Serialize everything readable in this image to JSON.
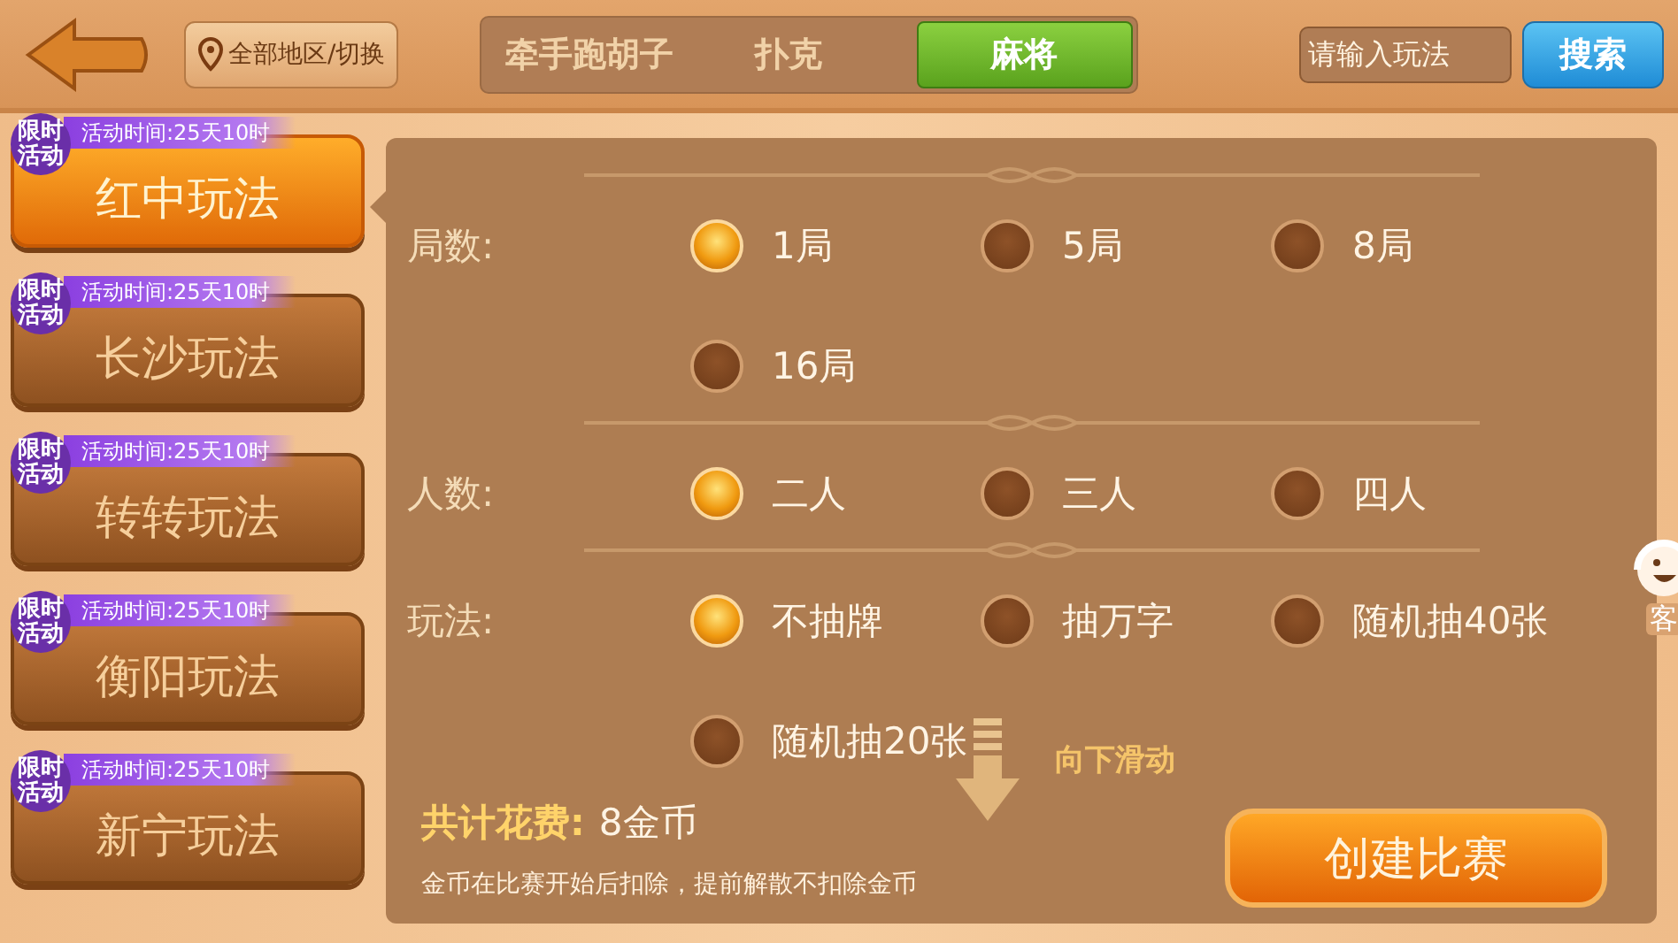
{
  "top_bar": {
    "region_button": "全部地区/切换",
    "tabs": [
      {
        "label": "牵手跑胡子",
        "selected": false
      },
      {
        "label": "扑克",
        "selected": false
      },
      {
        "label": "麻将",
        "selected": true
      }
    ],
    "search": {
      "placeholder": "请输入玩法"
    },
    "search_button": "搜索"
  },
  "modes": [
    {
      "tag": "限时活动",
      "timer": "活动时间:25天10时",
      "label": "红中玩法",
      "selected": true
    },
    {
      "tag": "限时活动",
      "timer": "活动时间:25天10时",
      "label": "长沙玩法",
      "selected": false
    },
    {
      "tag": "限时活动",
      "timer": "活动时间:25天10时",
      "label": "转转玩法",
      "selected": false
    },
    {
      "tag": "限时活动",
      "timer": "活动时间:25天10时",
      "label": "衡阳玩法",
      "selected": false
    },
    {
      "tag": "限时活动",
      "timer": "活动时间:25天10时",
      "label": "新宁玩法",
      "selected": false
    }
  ],
  "settings": [
    {
      "label": "局数:",
      "options": [
        {
          "label": "1局",
          "selected": true
        },
        {
          "label": "5局",
          "selected": false
        },
        {
          "label": "8局",
          "selected": false
        },
        {
          "label": "16局",
          "selected": false
        }
      ]
    },
    {
      "label": "人数:",
      "options": [
        {
          "label": "二人",
          "selected": true
        },
        {
          "label": "三人",
          "selected": false
        },
        {
          "label": "四人",
          "selected": false
        }
      ]
    },
    {
      "label": "玩法:",
      "options": [
        {
          "label": "不抽牌",
          "selected": true
        },
        {
          "label": "抽万字",
          "selected": false
        },
        {
          "label": "随机抽40张",
          "selected": false
        },
        {
          "label": "随机抽20张",
          "selected": false
        }
      ]
    }
  ],
  "scroll_hint": "向下滑动",
  "cost": {
    "label": "共计花费:",
    "value": "8金币",
    "note": "金币在比赛开始后扣除，提前解散不扣除金币"
  },
  "create_button": "创建比赛",
  "service": {
    "label": "客"
  }
}
